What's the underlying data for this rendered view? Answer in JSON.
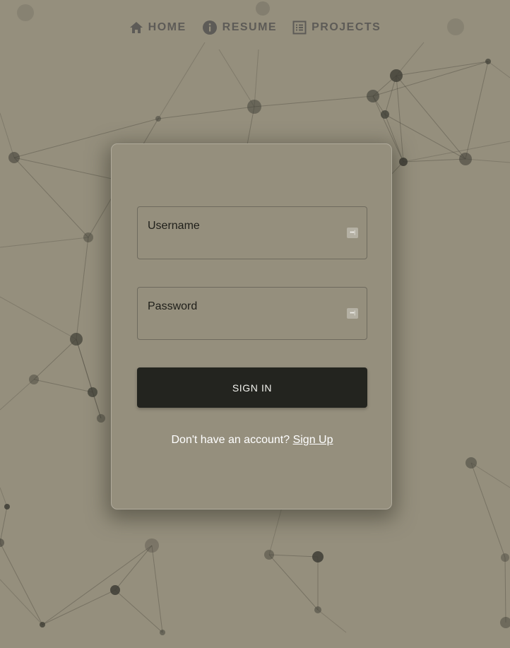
{
  "nav": {
    "items": [
      {
        "label": "HOME",
        "icon": "home-icon"
      },
      {
        "label": "RESUME",
        "icon": "info-icon"
      },
      {
        "label": "PROJECTS",
        "icon": "list-icon"
      }
    ]
  },
  "login": {
    "username_label": "Username",
    "username_value": "",
    "password_label": "Password",
    "password_value": "",
    "password_manager_icon": "password-manager-icon",
    "signin_label": "SIGN IN",
    "signup_prompt": "Don't have an account?",
    "signup_link": "Sign Up"
  },
  "colors": {
    "background": "#958f7d",
    "button": "#23241f",
    "nav_text": "#5d5b57",
    "node": "#3e3d35"
  }
}
